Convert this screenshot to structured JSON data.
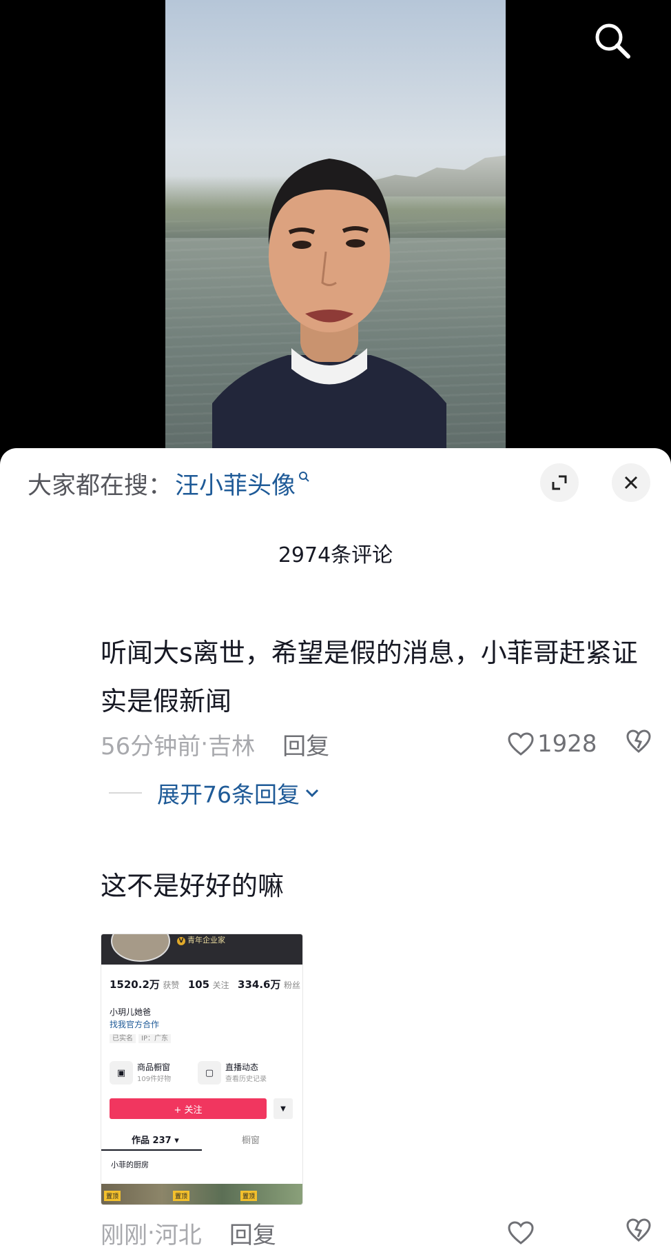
{
  "colors": {
    "link_blue": "#1e5a97",
    "follow_red": "#f1365f",
    "meta_gray": "#a8a9ad"
  },
  "video": {
    "icons": [
      "search-icon"
    ]
  },
  "sheet": {
    "search_prefix": "大家都在搜：",
    "search_term": "汪小菲头像",
    "icons": [
      "expand-icon",
      "close-icon"
    ],
    "comment_count": "2974条评论"
  },
  "comments": [
    {
      "text": "听闻大s离世，希望是假的消息，小菲哥赶紧证实是假新闻",
      "time": "56分钟前",
      "sep": " · ",
      "location": "吉林",
      "reply": "回复",
      "likes": "1928",
      "expand_replies": "展开76条回复"
    },
    {
      "text": "这不是好好的嘛",
      "time": "刚刚",
      "sep": " · ",
      "location": "河北",
      "reply": "回复",
      "likes": ""
    }
  ],
  "embed": {
    "badge": "青年企业家",
    "likes_num": "1520.2万",
    "likes_label": "获赞",
    "following_num": "105",
    "following_label": "关注",
    "fans_num": "334.6万",
    "fans_label": "粉丝",
    "name": "小玥儿她爸",
    "link": "找我官方合作",
    "tag1": "已实名",
    "tag2": "IP：广东",
    "card1_title": "商品橱窗",
    "card1_sub": "109件好物",
    "card2_title": "直播动态",
    "card2_sub": "查看历史记录",
    "follow_button": "+ 关注",
    "tab_works": "作品 237 ▾",
    "tab_window": "橱窗",
    "collection": "小菲的厨房",
    "pin1": "置顶",
    "pin2": "置顶",
    "pin3": "置顶"
  }
}
